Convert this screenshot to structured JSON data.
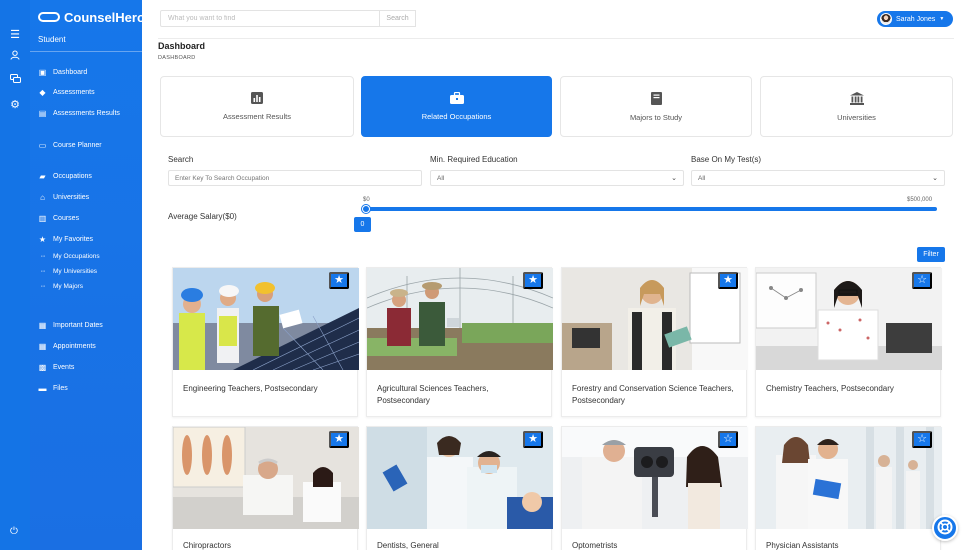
{
  "app": {
    "name": "CounselHero",
    "role": "Student"
  },
  "rail": {
    "icons": [
      "menu-icon",
      "user-icon",
      "chat-icon",
      "settings-icon"
    ]
  },
  "sidebar": {
    "items": [
      {
        "label": "Dashboard",
        "icon": "dashboard-icon"
      },
      {
        "label": "Assessments",
        "icon": "assessments-icon"
      },
      {
        "label": "Assessments Results",
        "icon": "results-icon"
      },
      {
        "label": "Course Planner",
        "icon": "laptop-icon"
      },
      {
        "label": "Occupations",
        "icon": "briefcase-icon"
      },
      {
        "label": "Universities",
        "icon": "university-icon"
      },
      {
        "label": "Courses",
        "icon": "book-open-icon"
      },
      {
        "label": "My Favorites",
        "icon": "star-icon"
      },
      {
        "label": "My Occupations",
        "icon": "dots-icon"
      },
      {
        "label": "My Universities",
        "icon": "dots-icon"
      },
      {
        "label": "My Majors",
        "icon": "dots-icon"
      },
      {
        "label": "Important Dates",
        "icon": "calendar-icon"
      },
      {
        "label": "Appointments",
        "icon": "calendar-check-icon"
      },
      {
        "label": "Events",
        "icon": "events-icon"
      },
      {
        "label": "Files",
        "icon": "folder-icon"
      }
    ]
  },
  "topbar": {
    "search_placeholder": "What you want to find",
    "search_button": "Search",
    "user_name": "Sarah Jones"
  },
  "page": {
    "title": "Dashboard",
    "breadcrumb": "DASHBOARD"
  },
  "tabs": [
    {
      "label": "Assessment Results",
      "icon": "bar-chart-icon",
      "active": false
    },
    {
      "label": "Related Occupations",
      "icon": "briefcase-icon",
      "active": true
    },
    {
      "label": "Majors to Study",
      "icon": "book-icon",
      "active": false
    },
    {
      "label": "Universities",
      "icon": "university-icon",
      "active": false
    }
  ],
  "filters": {
    "search_label": "Search",
    "search_placeholder": "Enter Key To Search Occupation",
    "education_label": "Min. Required Education",
    "education_value": "All",
    "tests_label": "Base On My Test(s)",
    "tests_value": "All",
    "salary_label": "Average Salary($0)",
    "salary_min_label": "$0",
    "salary_max_label": "$500,000",
    "salary_value": "0",
    "filter_button": "Filter"
  },
  "occupations": [
    {
      "title": "Engineering Teachers, Postsecondary",
      "favorited": true
    },
    {
      "title": "Agricultural Sciences Teachers, Postsecondary",
      "favorited": true
    },
    {
      "title": "Forestry and Conservation Science Teachers, Postsecondary",
      "favorited": true
    },
    {
      "title": "Chemistry Teachers, Postsecondary",
      "favorited": false
    },
    {
      "title": "Chiropractors",
      "favorited": true
    },
    {
      "title": "Dentists, General",
      "favorited": true
    },
    {
      "title": "Optometrists",
      "favorited": false
    },
    {
      "title": "Physician Assistants",
      "favorited": false
    }
  ],
  "colors": {
    "primary": "#1677ea",
    "sidebar": "#1a6fe3"
  }
}
